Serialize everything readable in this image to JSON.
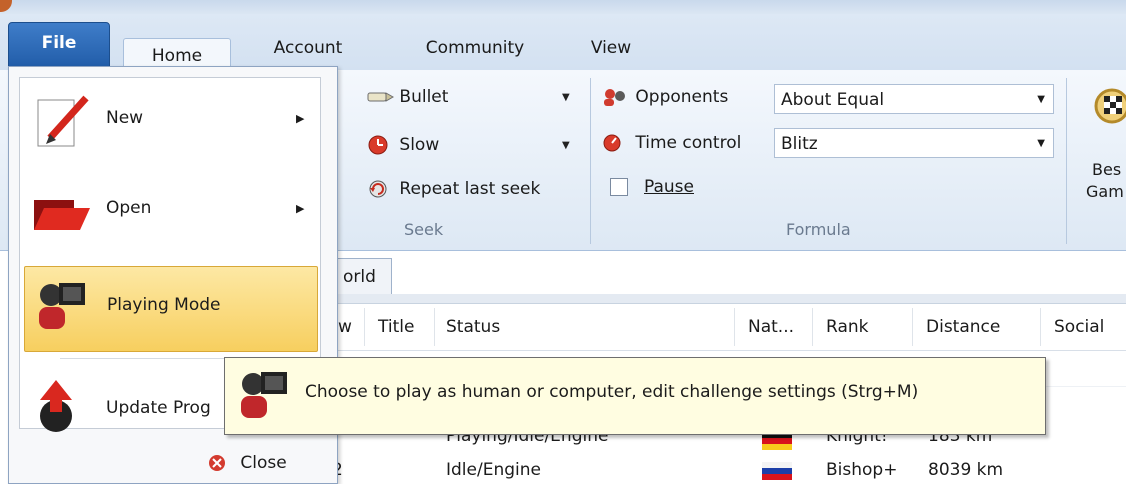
{
  "tabs": {
    "file": "File",
    "home": "Home",
    "account": "Account",
    "community": "Community",
    "view": "View"
  },
  "seek": {
    "bullet": "Bullet",
    "slow": "Slow",
    "repeat": "Repeat last seek",
    "group_label": "Seek"
  },
  "formula": {
    "opponents_label": "Opponents",
    "opponents_value": "About Equal",
    "time_control_label": "Time control",
    "time_control_value": "Blitz",
    "pause_label": "Pause",
    "group_label": "Formula"
  },
  "best_games": {
    "line1": "Bes",
    "line2": "Gam"
  },
  "list": {
    "world_tab": "orld",
    "headers": {
      "w": "w",
      "title": "Title",
      "status": "Status",
      "nat": "Nat...",
      "rank": "Rank",
      "distance": "Distance",
      "social": "Social"
    },
    "rows": [
      {
        "status": "Playing/Idle/Engine",
        "rank": "Knight!",
        "distance": "183 km",
        "flag": "de"
      },
      {
        "status": "Idle/Engine",
        "rank": "Bishop+",
        "distance": "8039 km",
        "flag": "ru",
        "left": "2"
      }
    ]
  },
  "file_menu": {
    "new": "New",
    "open": "Open",
    "playing_mode": "Playing Mode",
    "update": "Update Prog",
    "close": "Close"
  },
  "tooltip": {
    "text": "Choose to play as human or computer, edit challenge settings (Strg+M)"
  },
  "colors": {
    "accent": "#1f5aa6",
    "highlight": "#f7cf5f",
    "tooltip_bg": "#fffde1"
  }
}
